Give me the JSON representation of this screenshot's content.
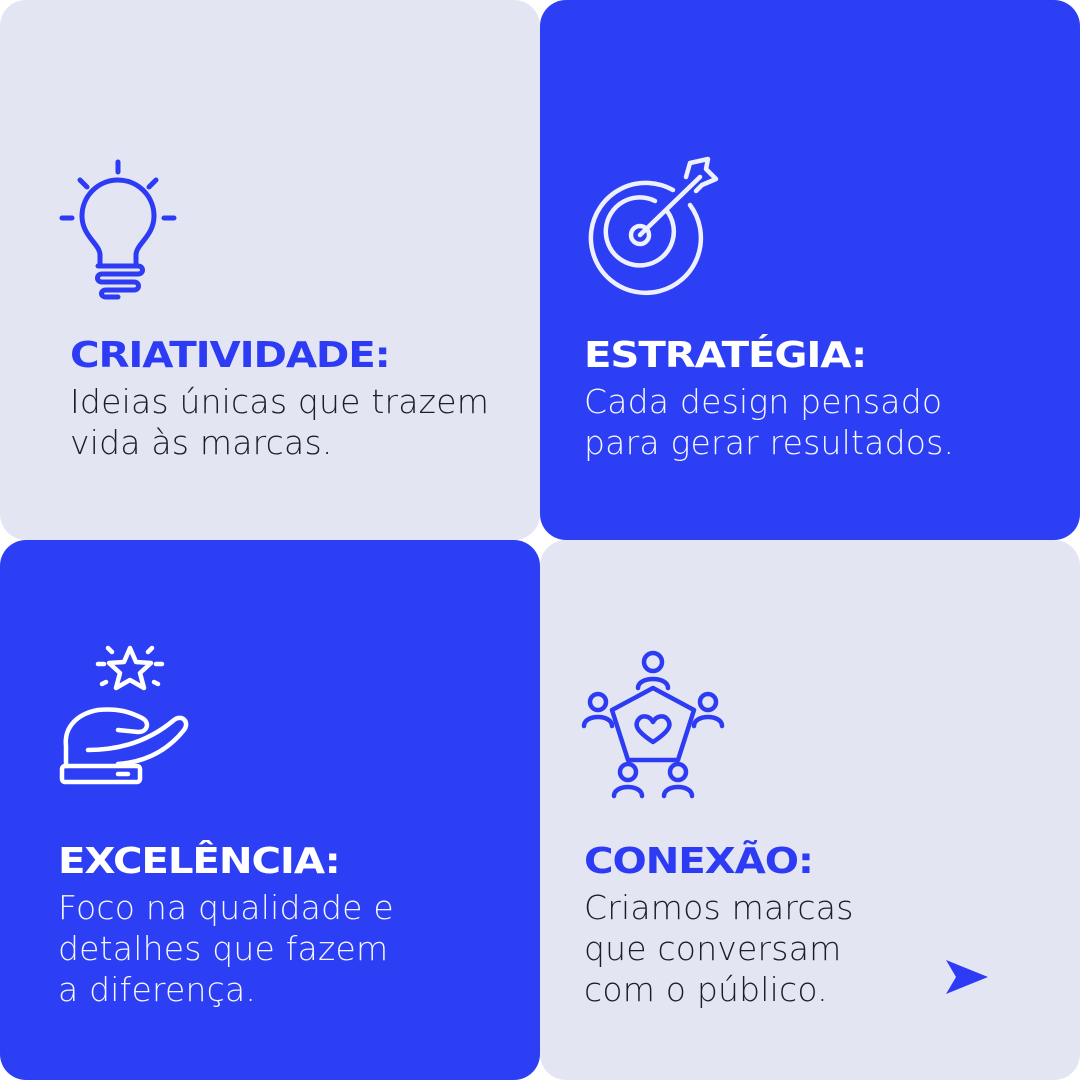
{
  "colors": {
    "accent_blue": "#2d3ff5",
    "light_bg": "#e3e5f2",
    "dark_text": "#1c1c2a"
  },
  "cards": [
    {
      "icon": "lightbulb-icon",
      "title": "Criatividade:",
      "lines": [
        "Ideias únicas que trazem",
        "vida às marcas."
      ]
    },
    {
      "icon": "target-arrow-icon",
      "title": "Estratégia:",
      "lines": [
        "Cada design pensado",
        "para gerar resultados."
      ]
    },
    {
      "icon": "hand-star-icon",
      "title": "Excelência:",
      "lines": [
        "Foco na qualidade e",
        "detalhes que fazem",
        "a diferença."
      ]
    },
    {
      "icon": "people-network-heart-icon",
      "title": "Conexão:",
      "lines": [
        "Criamos marcas",
        "que conversam",
        "com o público."
      ]
    }
  ],
  "next_button": {
    "icon": "arrow-right-icon"
  }
}
